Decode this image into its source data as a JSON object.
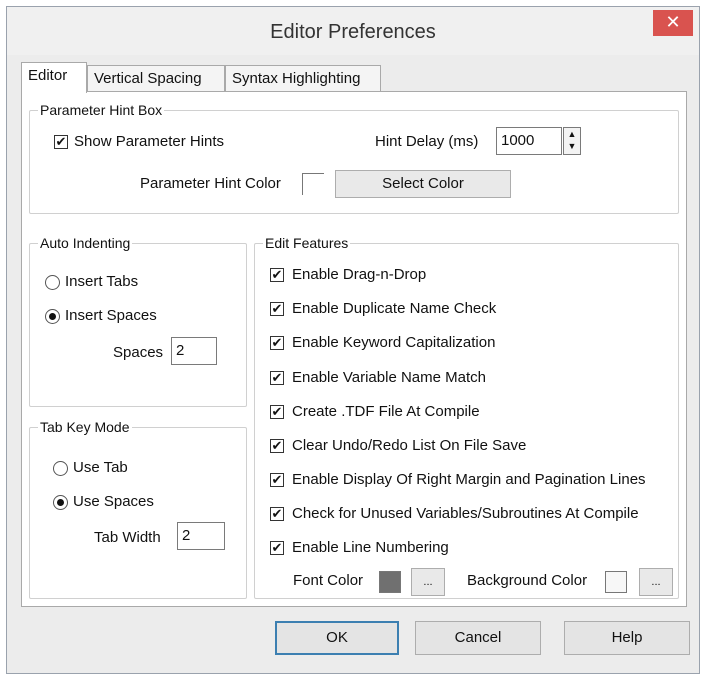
{
  "window": {
    "title": "Editor Preferences",
    "close_glyph": "✕"
  },
  "tabs": [
    {
      "label": "Editor",
      "active": true
    },
    {
      "label": "Vertical Spacing",
      "active": false
    },
    {
      "label": "Syntax Highlighting",
      "active": false
    }
  ],
  "parameter_hint_box": {
    "legend": "Parameter Hint Box",
    "show_hints_label": "Show Parameter Hints",
    "show_hints_checked": true,
    "hint_delay_label": "Hint Delay (ms)",
    "hint_delay_value": "1000",
    "hint_color_label": "Parameter Hint Color",
    "select_color_label": "Select Color"
  },
  "auto_indenting": {
    "legend": "Auto Indenting",
    "insert_tabs_label": "Insert Tabs",
    "insert_spaces_label": "Insert Spaces",
    "selected": "insert_spaces",
    "spaces_label": "Spaces",
    "spaces_value": "2"
  },
  "tab_key_mode": {
    "legend": "Tab Key  Mode",
    "use_tab_label": "Use Tab",
    "use_spaces_label": "Use Spaces",
    "selected": "use_spaces",
    "tab_width_label": "Tab Width",
    "tab_width_value": "2"
  },
  "edit_features": {
    "legend": "Edit Features",
    "items": [
      {
        "label": "Enable Drag-n-Drop",
        "checked": true
      },
      {
        "label": "Enable Duplicate Name Check",
        "checked": true
      },
      {
        "label": "Enable Keyword Capitalization",
        "checked": true
      },
      {
        "label": "Enable Variable Name Match",
        "checked": true
      },
      {
        "label": "Create .TDF File At Compile",
        "checked": true
      },
      {
        "label": "Clear Undo/Redo List On File Save",
        "checked": true
      },
      {
        "label": "Enable Display Of Right Margin and Pagination Lines",
        "checked": true
      },
      {
        "label": "Check for Unused Variables/Subroutines At Compile",
        "checked": true
      },
      {
        "label": "Enable Line Numbering",
        "checked": true
      }
    ],
    "font_color_label": "Font Color",
    "background_color_label": "Background Color",
    "ellipsis_label": "...",
    "font_color": "#707070",
    "background_color": "#f7f7f7"
  },
  "buttons": {
    "ok": "OK",
    "cancel": "Cancel",
    "help": "Help"
  },
  "colors": {
    "close_button": "#d9534f",
    "default_button_border": "#3c7fb1"
  },
  "glyphs": {
    "check": "✔",
    "spin_up": "▲",
    "spin_down": "▼"
  }
}
